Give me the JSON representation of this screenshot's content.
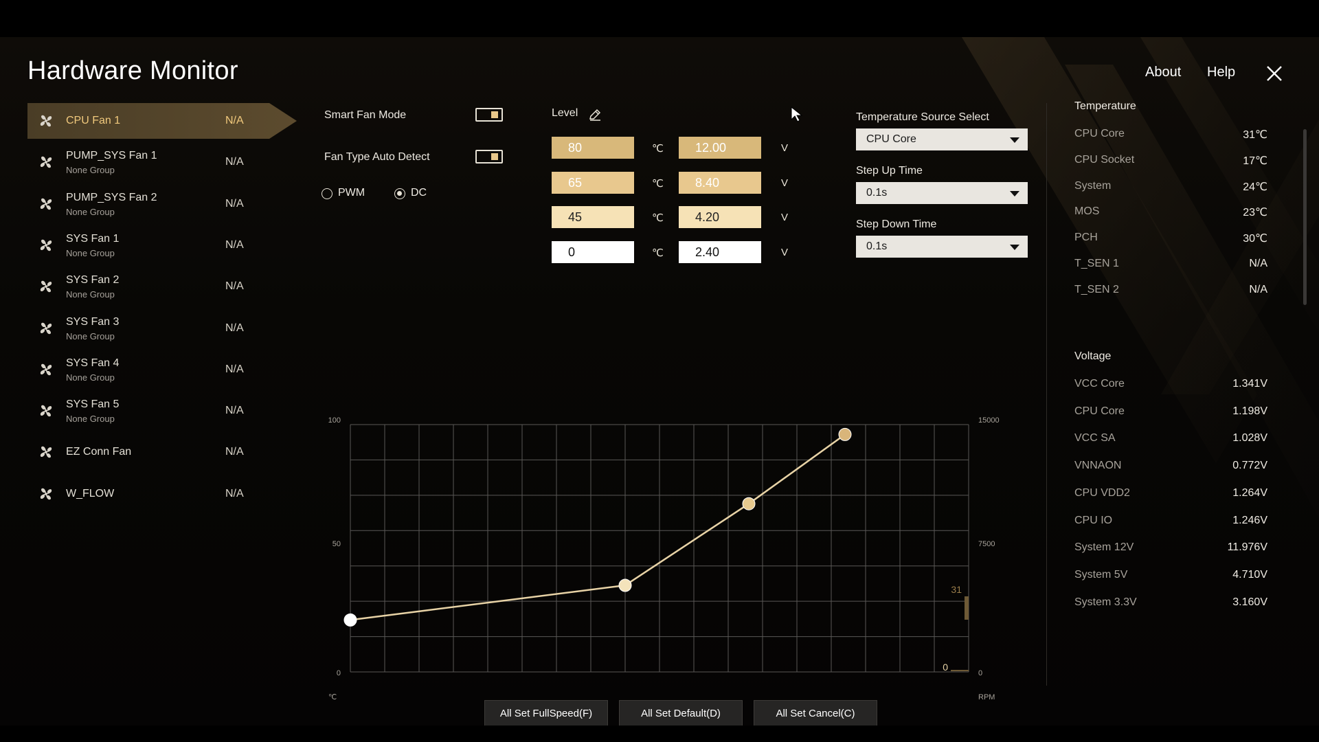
{
  "app": {
    "title": "Hardware Monitor"
  },
  "top_menu": {
    "about": "About",
    "help": "Help"
  },
  "fans": [
    {
      "name": "CPU Fan 1",
      "group": "",
      "value": "N/A",
      "active": true
    },
    {
      "name": "PUMP_SYS Fan 1",
      "group": "None Group",
      "value": "N/A"
    },
    {
      "name": "PUMP_SYS Fan 2",
      "group": "None Group",
      "value": "N/A"
    },
    {
      "name": "SYS Fan 1",
      "group": "None Group",
      "value": "N/A"
    },
    {
      "name": "SYS Fan 2",
      "group": "None Group",
      "value": "N/A"
    },
    {
      "name": "SYS Fan 3",
      "group": "None Group",
      "value": "N/A"
    },
    {
      "name": "SYS Fan 4",
      "group": "None Group",
      "value": "N/A"
    },
    {
      "name": "SYS Fan 5",
      "group": "None Group",
      "value": "N/A"
    },
    {
      "name": "EZ Conn Fan",
      "group": "",
      "value": "N/A"
    },
    {
      "name": "W_FLOW",
      "group": "",
      "value": "N/A"
    }
  ],
  "controls": {
    "smart_fan_mode": "Smart Fan Mode",
    "fan_type_auto_detect": "Fan Type Auto Detect",
    "pwm": "PWM",
    "dc": "DC",
    "level": "Level"
  },
  "levels": [
    {
      "temp": "80",
      "volt": "12.00"
    },
    {
      "temp": "65",
      "volt": "8.40"
    },
    {
      "temp": "45",
      "volt": "4.20"
    },
    {
      "temp": "0",
      "volt": "2.40"
    }
  ],
  "units": {
    "celsius": "℃",
    "volt": "V"
  },
  "level_colors": [
    "#d8b87a",
    "#e8c88e",
    "#f6e2b6",
    "#ffffff"
  ],
  "selects": {
    "temp_source_label": "Temperature Source Select",
    "temp_source_value": "CPU Core",
    "step_up_label": "Step Up Time",
    "step_up_value": "0.1s",
    "step_down_label": "Step Down Time",
    "step_down_value": "0.1s"
  },
  "temperature": {
    "title": "Temperature",
    "rows": [
      {
        "label": "CPU Core",
        "value": "31℃"
      },
      {
        "label": "CPU Socket",
        "value": "17℃"
      },
      {
        "label": "System",
        "value": "24℃"
      },
      {
        "label": "MOS",
        "value": "23℃"
      },
      {
        "label": "PCH",
        "value": "30℃"
      },
      {
        "label": "T_SEN 1",
        "value": "N/A"
      },
      {
        "label": "T_SEN 2",
        "value": "N/A"
      }
    ]
  },
  "voltage": {
    "title": "Voltage",
    "rows": [
      {
        "label": "VCC Core",
        "value": "1.341V"
      },
      {
        "label": "CPU Core",
        "value": "1.198V"
      },
      {
        "label": "VCC SA",
        "value": "1.028V"
      },
      {
        "label": "VNNAON",
        "value": "0.772V"
      },
      {
        "label": "CPU VDD2",
        "value": "1.264V"
      },
      {
        "label": "CPU IO",
        "value": "1.246V"
      },
      {
        "label": "System 12V",
        "value": "11.976V"
      },
      {
        "label": "System 5V",
        "value": "4.710V"
      },
      {
        "label": "System 3.3V",
        "value": "3.160V"
      }
    ]
  },
  "buttons": {
    "full_speed": "All Set FullSpeed(F)",
    "default": "All Set Default(D)",
    "cancel": "All Set Cancel(C)"
  },
  "chart_data": {
    "type": "line",
    "x_unit": "℃",
    "y_right_unit": "RPM",
    "y_left_ticks": [
      "100",
      "50",
      "0"
    ],
    "y_right_ticks": [
      "15000",
      "7500",
      "0"
    ],
    "xlim": [
      0,
      90
    ],
    "ylim": [
      0,
      100
    ],
    "points": [
      {
        "x": 0,
        "y": 21
      },
      {
        "x": 40,
        "y": 35
      },
      {
        "x": 58,
        "y": 68
      },
      {
        "x": 72,
        "y": 96
      }
    ],
    "point_colors": [
      "#ffffff",
      "#f4e3bb",
      "#e6c98e",
      "#d9b57a"
    ],
    "current_temp_label": "31",
    "current_rpm_label": "0",
    "grid": true,
    "line_color": "#e8d3a6"
  }
}
